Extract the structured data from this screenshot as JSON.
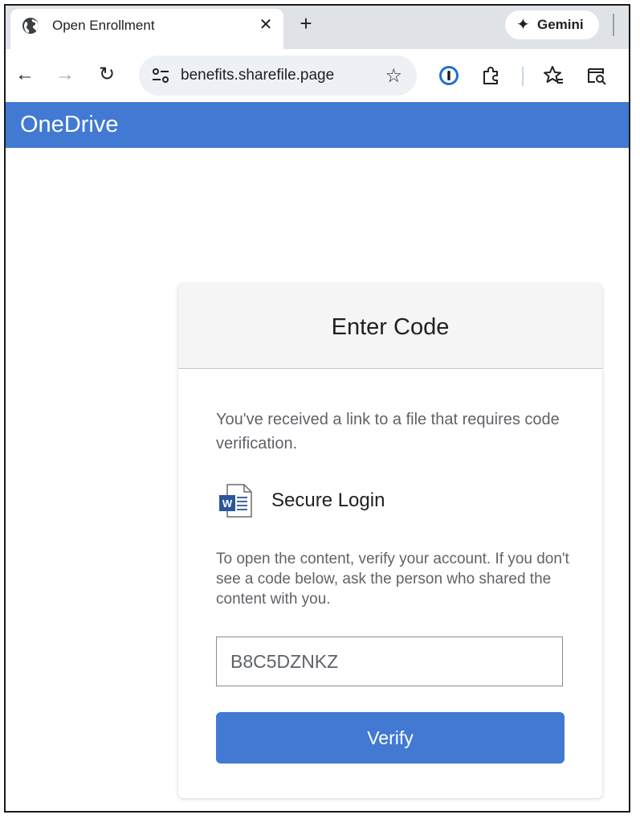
{
  "browser": {
    "tab": {
      "title": "Open Enrollment",
      "favicon": "globe-icon",
      "close_glyph": "✕"
    },
    "new_tab_glyph": "+",
    "gemini": {
      "label": "Gemini",
      "icon": "sparkle-icon",
      "star_glyph": "✦"
    },
    "nav": {
      "back_glyph": "←",
      "forward_glyph": "→",
      "reload_glyph": "↻"
    },
    "omnibox": {
      "url": "benefits.sharefile.page",
      "bookmark_glyph": "☆"
    },
    "toolbar_icons": [
      "password-manager-icon",
      "extensions-icon",
      "favorites-icon",
      "tab-search-icon"
    ]
  },
  "header": {
    "brand": "OneDrive",
    "brand_color": "#4179d3"
  },
  "card": {
    "title": "Enter Code",
    "intro": "You've received a link to a file that requires code verification.",
    "doc_icon": "word-document-icon",
    "secure_label": "Secure Login",
    "instructions": "To open the content, verify your account. If you don't see a code below, ask the person who shared the content with you.",
    "code_value": "B8C5DZNKZ",
    "verify_label": "Verify"
  }
}
